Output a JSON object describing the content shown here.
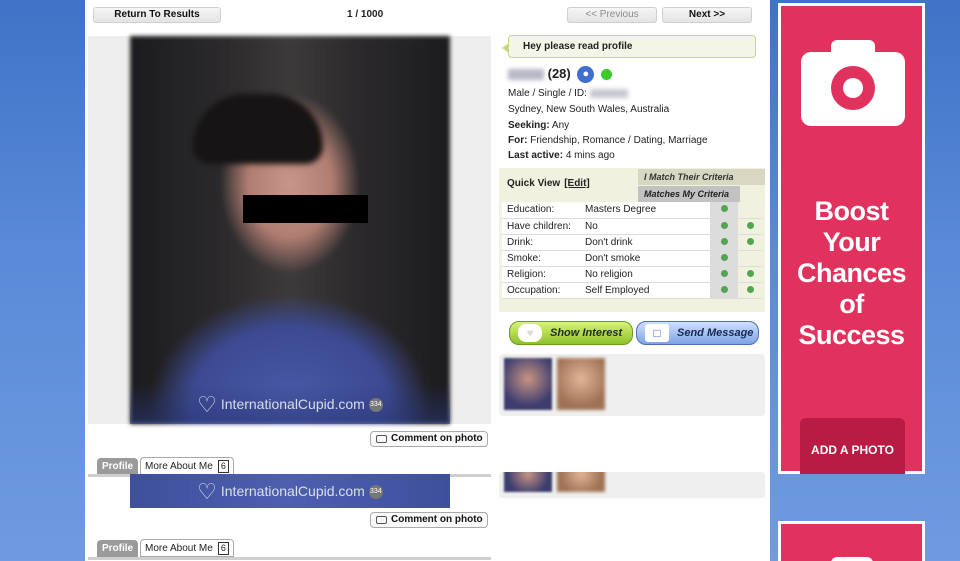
{
  "nav": {
    "return_label": "Return To Results",
    "counter": "1 / 1000",
    "previous_label": "<< Previous",
    "next_label": "Next >>"
  },
  "photo": {
    "watermark": "InternationalCupid.com",
    "photo_count": "334",
    "comment_label": "Comment on photo"
  },
  "tabs": {
    "profile_label": "Profile",
    "more_about_label": "More About Me",
    "more_about_count": "6"
  },
  "profile": {
    "headline": "Hey please read profile",
    "age": "(28)",
    "gender_status": "Male / Single / ID:",
    "location": "Sydney, New South Wales, Australia",
    "seeking_label": "Seeking:",
    "seeking_value": "Any",
    "for_label": "For:",
    "for_value": "Friendship, Romance / Dating, Marriage",
    "last_active_label": "Last active:",
    "last_active_value": "4 mins ago"
  },
  "quick_view": {
    "title": "Quick View",
    "edit_label": "[Edit]",
    "legend_match_their": "I Match Their Criteria",
    "legend_matches_my": "Matches My Criteria",
    "rows": [
      {
        "label": "Education:",
        "value": "Masters Degree",
        "match_mine": true,
        "match_theirs": false
      },
      {
        "label": "Have children:",
        "value": "No",
        "match_mine": true,
        "match_theirs": true
      },
      {
        "label": "Drink:",
        "value": "Don't drink",
        "match_mine": true,
        "match_theirs": true
      },
      {
        "label": "Smoke:",
        "value": "Don't smoke",
        "match_mine": true,
        "match_theirs": false
      },
      {
        "label": "Religion:",
        "value": "No religion",
        "match_mine": true,
        "match_theirs": true
      },
      {
        "label": "Occupation:",
        "value": "Self Employed",
        "match_mine": true,
        "match_theirs": true
      }
    ]
  },
  "actions": {
    "show_interest": "Show Interest",
    "send_message": "Send Message"
  },
  "ad": {
    "headline_lines": [
      "Boost",
      "Your",
      "Chances",
      "of",
      "Success"
    ],
    "cta": "ADD A PHOTO",
    "color": "#e0325d"
  }
}
